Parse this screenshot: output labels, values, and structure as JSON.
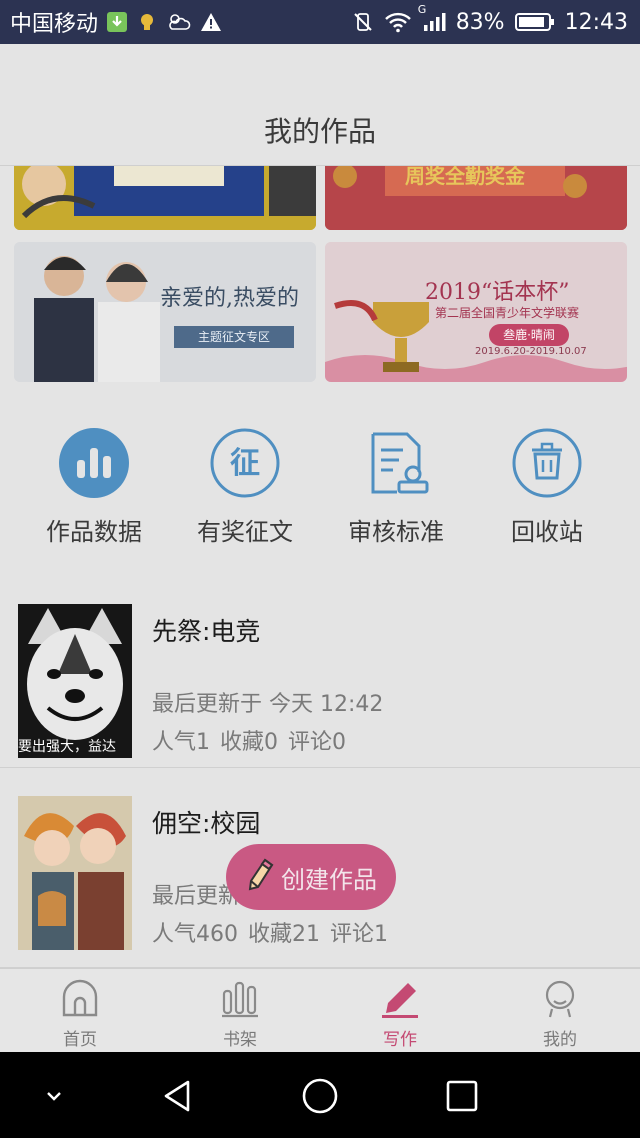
{
  "status_bar": {
    "carrier": "中国移动",
    "network": "G",
    "battery_pct": "83%",
    "time": "12:43"
  },
  "header": {
    "title": "我的作品"
  },
  "banners": {
    "b2_text": "周奖全勤奖金",
    "b3_title": "亲爱的,热爱的",
    "b3_sub": "主题征文专区",
    "b4_title": "2019“话本杯”",
    "b4_sub": "第二届全国青少年文学联赛",
    "b4_pill": "叁鹿·晴闹",
    "b4_date": "2019.6.20-2019.10.07"
  },
  "tools": [
    {
      "label": "作品数据",
      "icon": "bar-chart-icon"
    },
    {
      "label": "有奖征文",
      "icon": "contest-icon"
    },
    {
      "label": "审核标准",
      "icon": "review-doc-icon"
    },
    {
      "label": "回收站",
      "icon": "trash-icon"
    }
  ],
  "works": [
    {
      "title": "先祭:电竞",
      "updated": "最后更新于 今天 12:42",
      "popularity": "人气1",
      "favorites": "收藏0",
      "comments": "评论0",
      "cover_caption": "要出强大，益达"
    },
    {
      "title": "佣空:校园",
      "updated": "最后更新",
      "popularity": "人气460",
      "favorites": "收藏21",
      "comments": "评论1"
    }
  ],
  "fab": {
    "label": "创建作品"
  },
  "tabbar": {
    "active": "写作",
    "items": [
      {
        "label": "首页",
        "icon": "home-icon"
      },
      {
        "label": "书架",
        "icon": "bookshelf-icon"
      },
      {
        "label": "写作",
        "icon": "pen-icon"
      },
      {
        "label": "我的",
        "icon": "profile-icon"
      }
    ]
  },
  "colors": {
    "accent": "#c95983",
    "tool_icon": "#4f8fc1",
    "status_bar": "#2c3352"
  }
}
